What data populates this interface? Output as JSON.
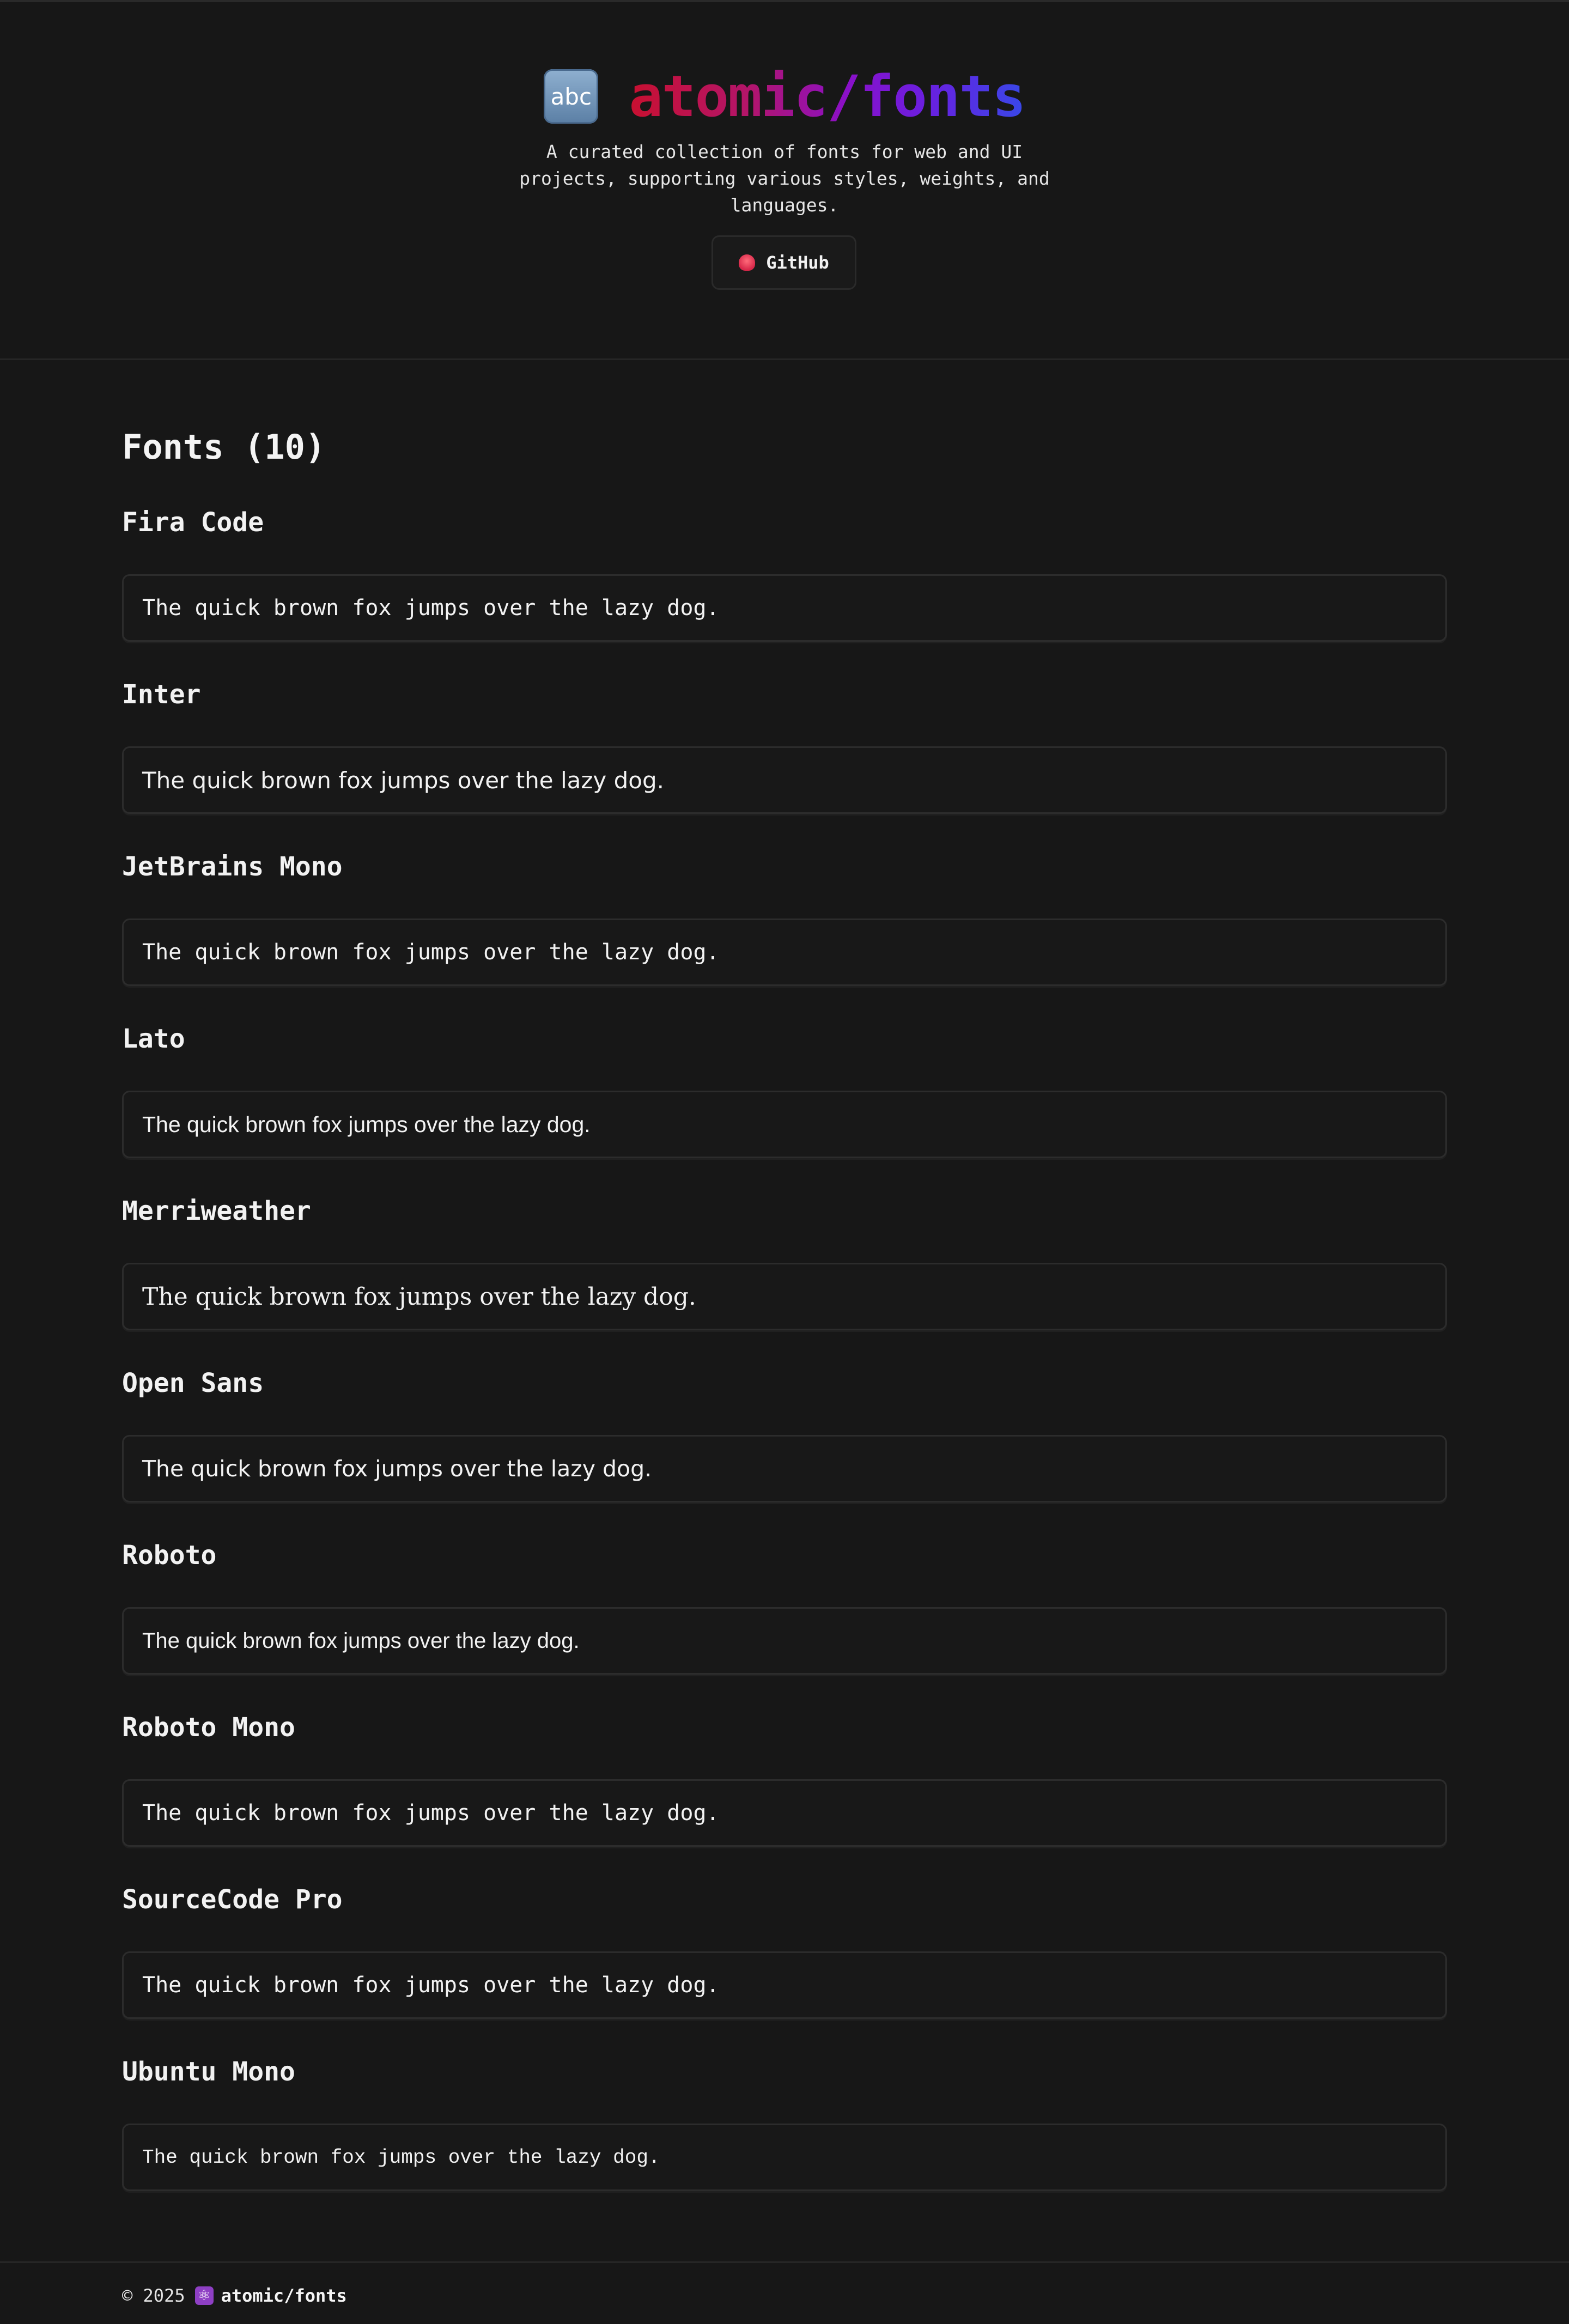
{
  "header": {
    "icon_text": "abc",
    "title": "atomic/fonts",
    "tagline": "A curated collection of fonts for web and UI projects, supporting various styles, weights, and languages.",
    "github_label": "GitHub"
  },
  "main": {
    "section_title": "Fonts (10)",
    "fonts": [
      {
        "name": "Fira Code",
        "sample": "The quick brown fox jumps over the lazy dog."
      },
      {
        "name": "Inter",
        "sample": "The quick brown fox jumps over the lazy dog."
      },
      {
        "name": "JetBrains Mono",
        "sample": "The quick brown fox jumps over the lazy dog."
      },
      {
        "name": "Lato",
        "sample": "The quick brown fox jumps over the lazy dog."
      },
      {
        "name": "Merriweather",
        "sample": "The quick brown fox jumps over the lazy dog."
      },
      {
        "name": "Open Sans",
        "sample": "The quick brown fox jumps over the lazy dog."
      },
      {
        "name": "Roboto",
        "sample": "The quick brown fox jumps over the lazy dog."
      },
      {
        "name": "Roboto Mono",
        "sample": "The quick brown fox jumps over the lazy dog."
      },
      {
        "name": "SourceCode Pro",
        "sample": "The quick brown fox jumps over the lazy dog."
      },
      {
        "name": "Ubuntu Mono",
        "sample": "The quick brown fox jumps over the lazy dog."
      }
    ]
  },
  "footer": {
    "copyright": "© 2025",
    "icon": "atom-icon",
    "brand": "atomic/fonts"
  },
  "colors": {
    "background": "#171717",
    "title_gradient_start": "#c81030",
    "title_gradient_mid": "#8a10c8",
    "title_gradient_end": "#3848e8"
  }
}
